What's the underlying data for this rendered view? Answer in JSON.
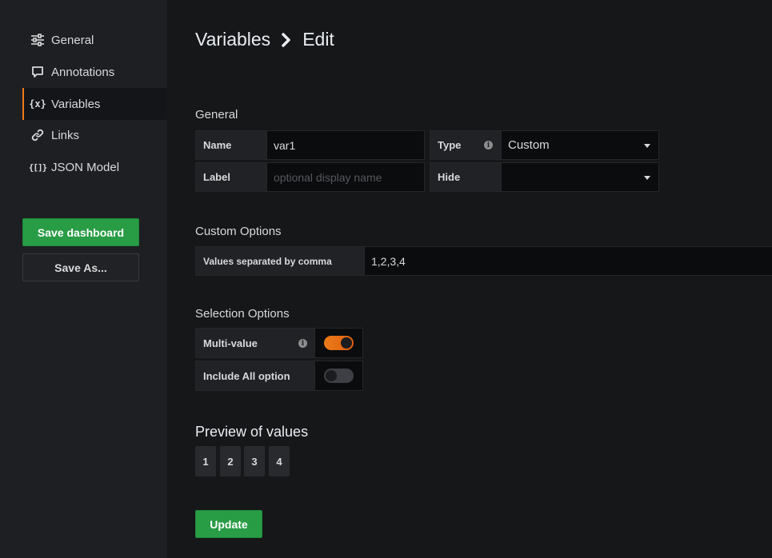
{
  "sidebar": {
    "items": [
      {
        "label": "General",
        "icon": "sliders-icon"
      },
      {
        "label": "Annotations",
        "icon": "comment-icon"
      },
      {
        "label": "Variables",
        "icon": "variable-icon"
      },
      {
        "label": "Links",
        "icon": "link-icon"
      },
      {
        "label": "JSON Model",
        "icon": "json-icon"
      }
    ],
    "variables_icon_text": "{x}",
    "json_icon_text": "{[]}",
    "active_index": 2,
    "save_dashboard_label": "Save dashboard",
    "save_as_label": "Save As..."
  },
  "header": {
    "crumb_parent": "Variables",
    "crumb_current": "Edit"
  },
  "general": {
    "section_title": "General",
    "name_label": "Name",
    "name_value": "var1",
    "type_label": "Type",
    "type_value": "Custom",
    "label_label": "Label",
    "label_placeholder": "optional display name",
    "hide_label": "Hide",
    "hide_value": ""
  },
  "custom_options": {
    "section_title": "Custom Options",
    "values_label": "Values separated by comma",
    "values_value": "1,2,3,4"
  },
  "selection_options": {
    "section_title": "Selection Options",
    "multi_value_label": "Multi-value",
    "multi_value_enabled": true,
    "include_all_label": "Include All option",
    "include_all_enabled": false
  },
  "preview": {
    "title": "Preview of values",
    "values": [
      "1",
      "2",
      "3",
      "4"
    ]
  },
  "update_label": "Update",
  "colors": {
    "accent": "#eb7b18",
    "primary_button": "#299c46",
    "background": "#161719",
    "sidebar": "#1e1f22"
  }
}
